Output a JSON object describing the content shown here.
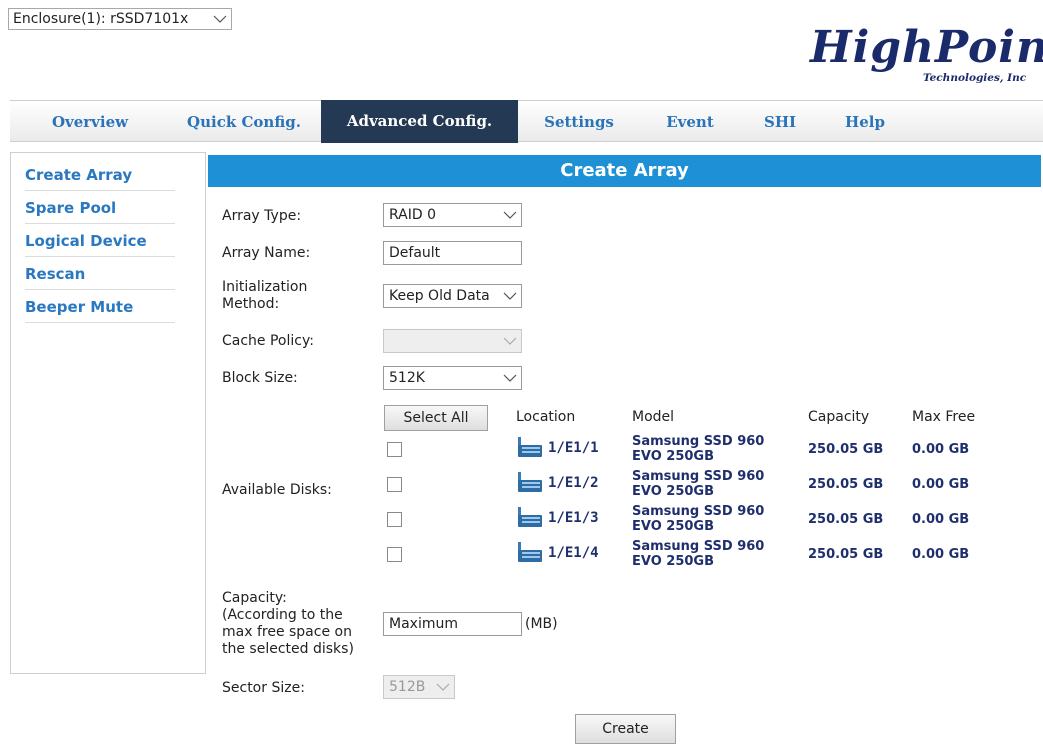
{
  "enclosure": {
    "selected": "Enclosure(1): rSSD7101x"
  },
  "logo": {
    "main": "HighPoint",
    "sub": "Technologies, Inc"
  },
  "nav": {
    "tabs": [
      {
        "label": "Overview"
      },
      {
        "label": "Quick Config."
      },
      {
        "label": "Advanced Config."
      },
      {
        "label": "Settings"
      },
      {
        "label": "Event"
      },
      {
        "label": "SHI"
      },
      {
        "label": "Help"
      }
    ],
    "active_tab": "Advanced Config."
  },
  "sidebar": {
    "items": [
      {
        "label": "Create Array"
      },
      {
        "label": "Spare Pool"
      },
      {
        "label": "Logical Device"
      },
      {
        "label": "Rescan"
      },
      {
        "label": "Beeper Mute"
      }
    ]
  },
  "form": {
    "title": "Create Array",
    "array_type": {
      "label": "Array Type:",
      "value": "RAID 0"
    },
    "array_name": {
      "label": "Array Name:",
      "value": "Default"
    },
    "init_method": {
      "label_line1": "Initialization",
      "label_line2": "Method:",
      "value": "Keep Old Data"
    },
    "cache_policy": {
      "label": "Cache Policy:",
      "value": ""
    },
    "block_size": {
      "label": "Block Size:",
      "value": "512K"
    },
    "available_disks": {
      "label": "Available Disks:",
      "select_all": "Select All",
      "columns": {
        "location": "Location",
        "model": "Model",
        "capacity": "Capacity",
        "max_free": "Max Free"
      },
      "disks": [
        {
          "location": "1/E1/1",
          "model_line1": "Samsung SSD 960",
          "model_line2": "EVO 250GB",
          "capacity": "250.05 GB",
          "max_free": "0.00 GB",
          "checked": false
        },
        {
          "location": "1/E1/2",
          "model_line1": "Samsung SSD 960",
          "model_line2": "EVO 250GB",
          "capacity": "250.05 GB",
          "max_free": "0.00 GB",
          "checked": false
        },
        {
          "location": "1/E1/3",
          "model_line1": "Samsung SSD 960",
          "model_line2": "EVO 250GB",
          "capacity": "250.05 GB",
          "max_free": "0.00 GB",
          "checked": false
        },
        {
          "location": "1/E1/4",
          "model_line1": "Samsung SSD 960",
          "model_line2": "EVO 250GB",
          "capacity": "250.05 GB",
          "max_free": "0.00 GB",
          "checked": false
        }
      ]
    },
    "capacity": {
      "label_line1": "Capacity:",
      "label_line2": "(According to the",
      "label_line3": "max free space on",
      "label_line4": "the selected disks)",
      "value": "Maximum",
      "unit": "(MB)"
    },
    "sector_size": {
      "label": "Sector Size:",
      "value": "512B"
    },
    "create_button": "Create"
  },
  "colors": {
    "banner": "#1e90d6",
    "active_tab": "#243a54",
    "link_blue": "#2a78c0",
    "value_navy": "#1f2f6e"
  }
}
